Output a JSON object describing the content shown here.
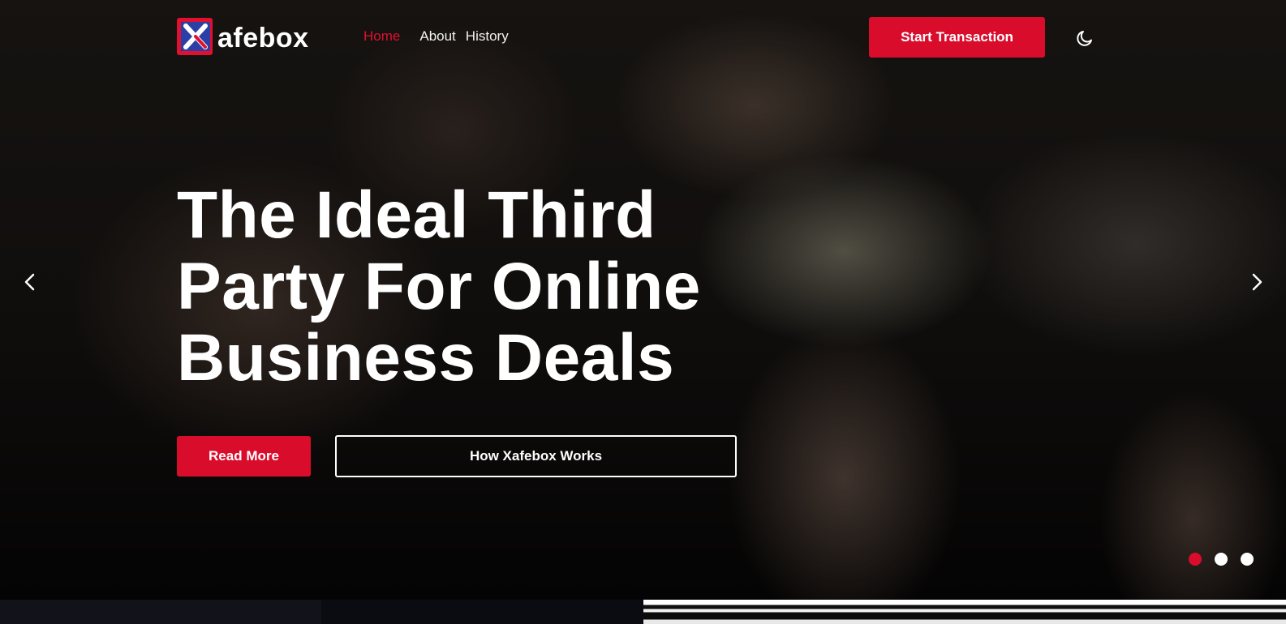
{
  "brand": {
    "name": "afebox",
    "logo_letter": "X",
    "colors": {
      "primary_red": "#da0c2c",
      "logo_blue": "#2b3fa6"
    }
  },
  "nav": {
    "items": [
      {
        "label": "Home",
        "active": true
      },
      {
        "label": "About",
        "active": false
      },
      {
        "label": "History",
        "active": false
      }
    ]
  },
  "header": {
    "cta_label": "Start Transaction",
    "theme_toggle_icon": "moon-icon"
  },
  "hero": {
    "headline": "The Ideal Third Party For Online Business Deals",
    "primary_button": "Read More",
    "secondary_button": "How Xafebox Works",
    "prev_icon": "chevron-left-icon",
    "next_icon": "chevron-right-icon",
    "slides": {
      "count": 3,
      "active_index": 0
    }
  }
}
